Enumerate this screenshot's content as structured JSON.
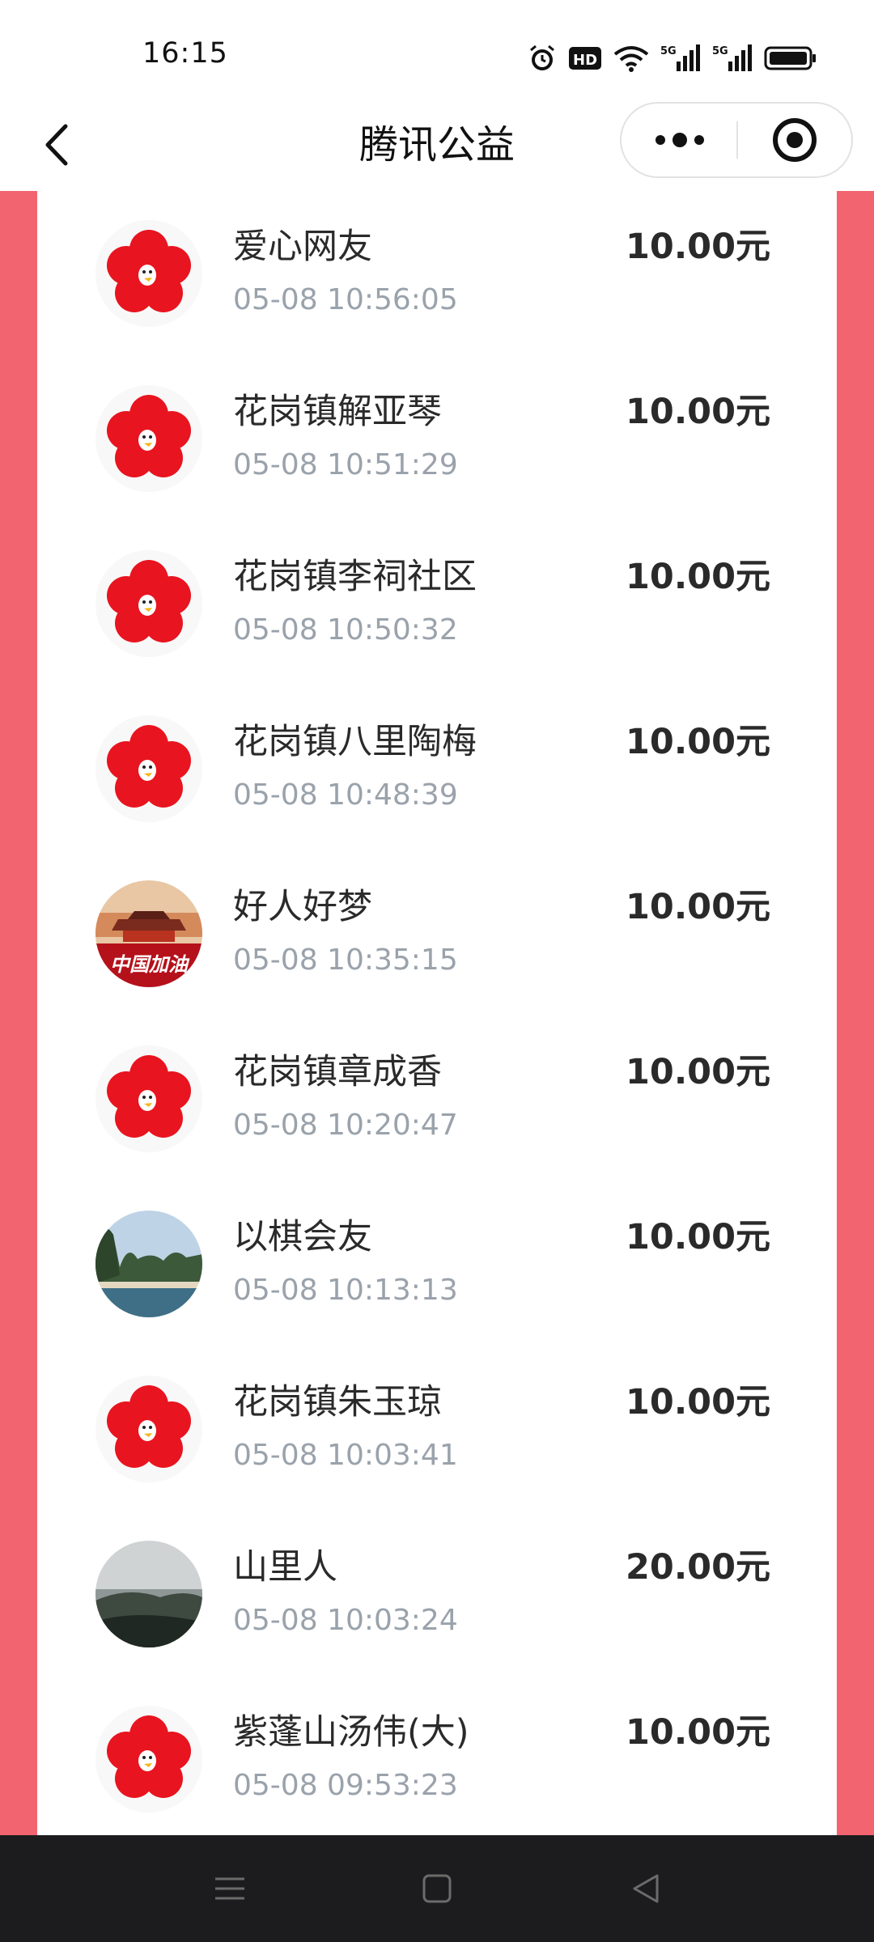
{
  "status_bar": {
    "time": "16:15",
    "icons": [
      "alarm-icon",
      "hd-voice-icon",
      "wifi-icon",
      "5g-signal-icon",
      "5g-signal-icon",
      "battery-icon"
    ],
    "hd_label": "HD",
    "network_label": "5G"
  },
  "nav": {
    "title": "腾讯公益",
    "back_icon": "chevron-left-icon",
    "more_icon": "more-dots-icon",
    "close_icon": "target-close-icon"
  },
  "colors": {
    "accent": "#f26470",
    "time_text": "#9aa2ab",
    "nav_bar_bg": "#1c1c1e"
  },
  "donations": [
    {
      "name": "爱心网友",
      "time": "05-08 10:56:05",
      "amount": "10.00元",
      "avatar": "red-flower-logo"
    },
    {
      "name": "花岗镇解亚琴",
      "time": "05-08 10:51:29",
      "amount": "10.00元",
      "avatar": "red-flower-logo"
    },
    {
      "name": "花岗镇李祠社区",
      "time": "05-08 10:50:32",
      "amount": "10.00元",
      "avatar": "red-flower-logo"
    },
    {
      "name": "花岗镇八里陶梅",
      "time": "05-08 10:48:39",
      "amount": "10.00元",
      "avatar": "red-flower-logo"
    },
    {
      "name": "好人好梦",
      "time": "05-08 10:35:15",
      "amount": "10.00元",
      "avatar": "tiananmen-photo",
      "avatar_caption": "中国加油"
    },
    {
      "name": "花岗镇章成香",
      "time": "05-08 10:20:47",
      "amount": "10.00元",
      "avatar": "red-flower-logo"
    },
    {
      "name": "以棋会友",
      "time": "05-08 10:13:13",
      "amount": "10.00元",
      "avatar": "karst-landscape-photo"
    },
    {
      "name": "花岗镇朱玉琼",
      "time": "05-08 10:03:41",
      "amount": "10.00元",
      "avatar": "red-flower-logo"
    },
    {
      "name": "山里人",
      "time": "05-08 10:03:24",
      "amount": "20.00元",
      "avatar": "misty-mountain-photo"
    },
    {
      "name": "紫蓬山汤伟(大)",
      "time": "05-08 09:53:23",
      "amount": "10.00元",
      "avatar": "red-flower-logo"
    }
  ],
  "bottom_nav": {
    "icons": [
      "menu-icon",
      "home-square-icon",
      "back-triangle-icon"
    ]
  }
}
